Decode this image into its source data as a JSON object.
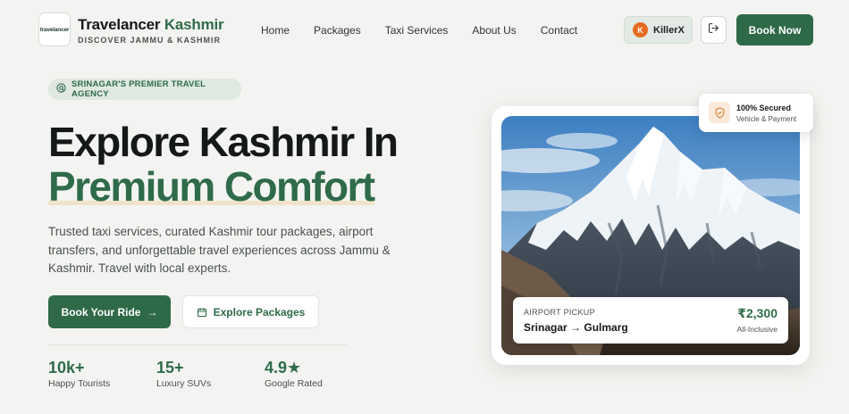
{
  "brand": {
    "logo_text": "travelancer",
    "title_part1": "Travelancer ",
    "title_part2": "Kashmir",
    "subtitle": "DISCOVER JAMMU & KASHMIR"
  },
  "nav": {
    "items": [
      {
        "label": "Home"
      },
      {
        "label": "Packages"
      },
      {
        "label": "Taxi Services"
      },
      {
        "label": "About Us"
      },
      {
        "label": "Contact"
      }
    ]
  },
  "user": {
    "initial": "K",
    "name": "KillerX",
    "avatar_color": "#e66a1f"
  },
  "header": {
    "book_now_label": "Book Now",
    "logout_icon": "logout-icon"
  },
  "hero": {
    "badge_text": "SRINAGAR'S PREMIER TRAVEL AGENCY",
    "headline_line1": "Explore Kashmir In",
    "headline_line2": "Premium Comfort",
    "description": "Trusted taxi services, curated Kashmir tour packages, airport transfers, and unforgettable travel experiences across Jammu & Kashmir. Travel with local experts.",
    "primary_button": "Book Your Ride",
    "primary_button_icon": "→",
    "secondary_button": "Explore Packages",
    "stats": [
      {
        "value": "10k+",
        "label": "Happy Tourists"
      },
      {
        "value": "15+",
        "label": "Luxury SUVs"
      },
      {
        "value": "4.9★",
        "label": "Google Rated"
      }
    ]
  },
  "card": {
    "pickup_label": "AIRPORT PICKUP",
    "route": "Srinagar → Gulmarg",
    "price": "₹2,300",
    "price_note": "All-Inclusive"
  },
  "secure_badge": {
    "title": "100% Secured",
    "subtitle": "Vehicle & Payment"
  },
  "colors": {
    "brand_green": "#2e6a47",
    "background": "#f3f4f1",
    "accent_orange": "#e66a1f"
  }
}
